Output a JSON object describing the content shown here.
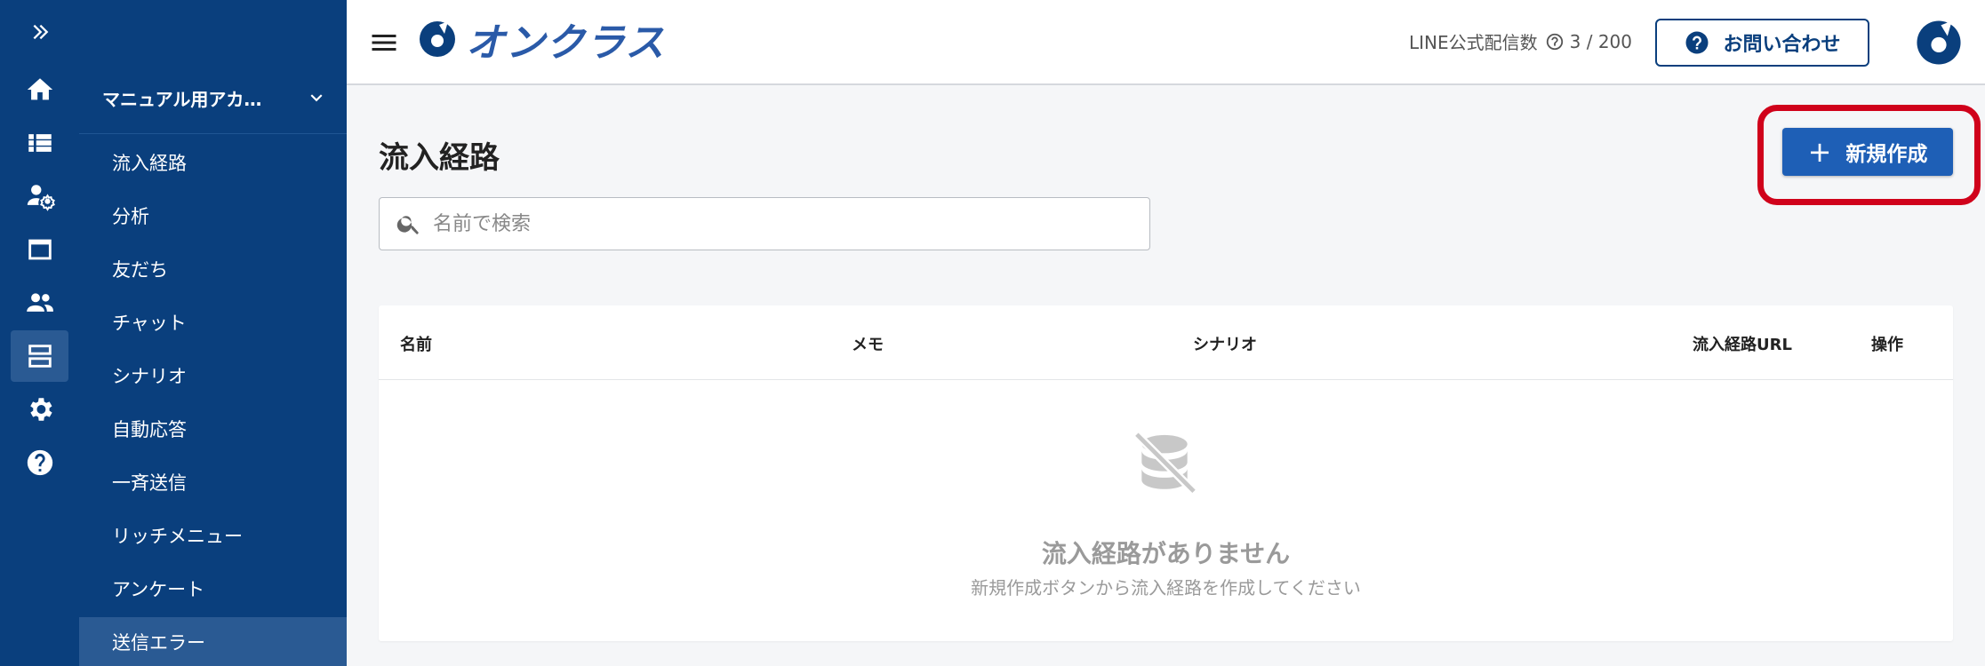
{
  "colors": {
    "sidebar": "#0a3f7d",
    "accent": "#1e5fb6",
    "highlight": "#d0021b"
  },
  "rail": {
    "expand_icon": "double-chevron-right-icon",
    "items": [
      {
        "icon": "home-icon"
      },
      {
        "icon": "list-icon"
      },
      {
        "icon": "user-settings-icon"
      },
      {
        "icon": "window-icon"
      },
      {
        "icon": "people-icon"
      },
      {
        "icon": "storage-icon",
        "active": true
      },
      {
        "icon": "gear-icon"
      },
      {
        "icon": "help-icon"
      }
    ]
  },
  "sidebar": {
    "account_name": "マニュアル用アカ…",
    "items": [
      {
        "label": "流入経路"
      },
      {
        "label": "分析"
      },
      {
        "label": "友だち"
      },
      {
        "label": "チャット"
      },
      {
        "label": "シナリオ"
      },
      {
        "label": "自動応答"
      },
      {
        "label": "一斉送信"
      },
      {
        "label": "リッチメニュー"
      },
      {
        "label": "アンケート"
      },
      {
        "label": "送信エラー",
        "active": true
      }
    ]
  },
  "header": {
    "logo_text": "オンクラス",
    "quota_label": "LINE公式配信数",
    "quota_value": "3 / 200",
    "contact_label": "お問い合わせ"
  },
  "main": {
    "title": "流入経路",
    "search_placeholder": "名前で検索",
    "new_button_label": "新規作成",
    "table": {
      "columns": [
        "名前",
        "メモ",
        "シナリオ",
        "流入経路URL",
        "操作"
      ],
      "empty_title": "流入経路がありません",
      "empty_subtitle": "新規作成ボタンから流入経路を作成してください"
    }
  }
}
